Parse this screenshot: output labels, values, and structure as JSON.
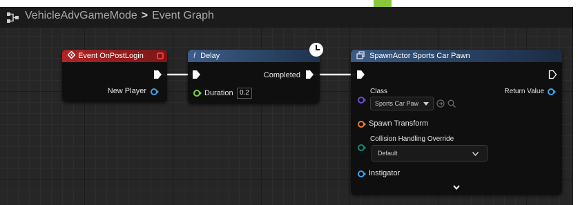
{
  "breadcrumb": {
    "blueprint": "VehicleAdvGameMode",
    "separator": ">",
    "graph": "Event Graph"
  },
  "nodes": {
    "event_post_login": {
      "title": "Event OnPostLogin",
      "output_label": "New Player",
      "header_color": "#a31f1f"
    },
    "delay": {
      "title": "Delay",
      "function_glyph": "f",
      "completed_label": "Completed",
      "duration_label": "Duration",
      "duration_value": "0.2",
      "header_color": "#304c72"
    },
    "spawn_actor": {
      "title": "SpawnActor Sports Car Pawn",
      "class_label": "Class",
      "class_value": "Sports Car Paw",
      "return_value_label": "Return Value",
      "spawn_transform_label": "Spawn Transform",
      "collision_label": "Collision Handling Override",
      "collision_value": "Default",
      "instigator_label": "Instigator",
      "header_color": "#2d4566"
    }
  },
  "colors": {
    "exec_pin": "#ffffff",
    "object_pin": "#3da0e8",
    "float_pin": "#73d14a",
    "class_pin": "#6f4bd6",
    "struct_pin": "#f07a2c",
    "enum_pin": "#0f8a78",
    "accent": "#8cc63f"
  },
  "icons": [
    "graph-icon",
    "event-icon",
    "delegate-pin-icon",
    "clock-icon",
    "spawn-actor-icon",
    "use-selected-icon",
    "browse-icon",
    "chevron-down-icon",
    "expand-arrow-icon"
  ]
}
